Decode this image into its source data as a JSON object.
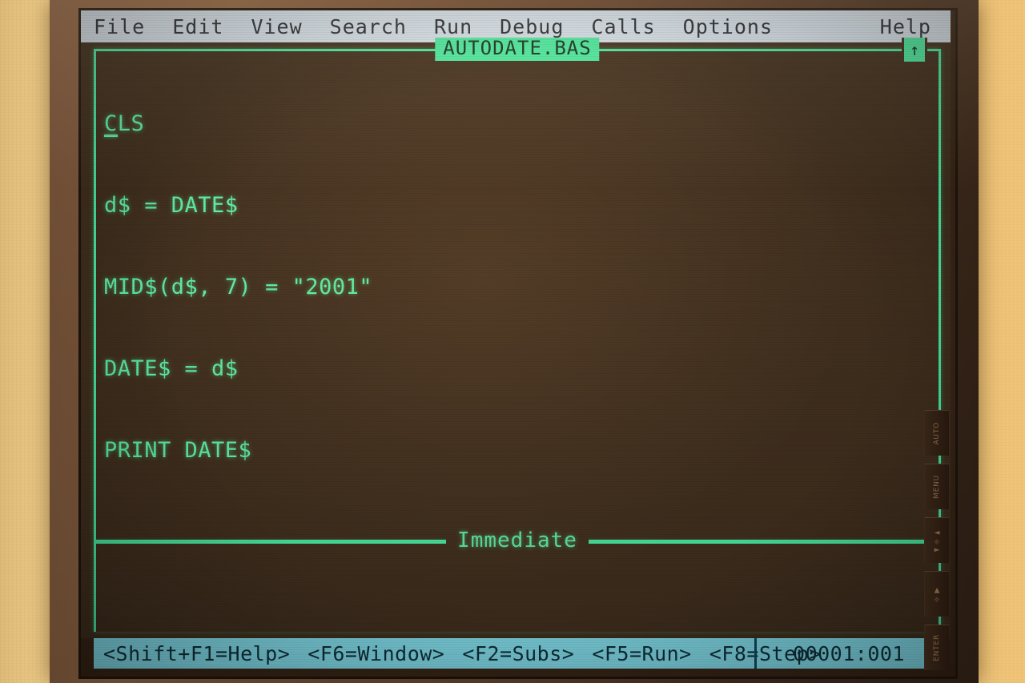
{
  "menu": {
    "items": [
      {
        "label": "File"
      },
      {
        "label": "Edit"
      },
      {
        "label": "View"
      },
      {
        "label": "Search"
      },
      {
        "label": "Run"
      },
      {
        "label": "Debug"
      },
      {
        "label": "Calls"
      },
      {
        "label": "Options"
      }
    ],
    "help_label": "Help"
  },
  "edit_window": {
    "title": "AUTODATE.BAS",
    "scroll_up_icon": "↑",
    "code_lines": [
      "CLS",
      "d$ = DATE$",
      "MID$(d$, 7) = \"2001\"",
      "DATE$ = d$",
      "PRINT DATE$"
    ]
  },
  "immediate_window": {
    "title": "Immediate",
    "content": ""
  },
  "statusbar": {
    "keys": [
      "<Shift+F1=Help>",
      "<F6=Window>",
      "<F2=Subs>",
      "<F5=Run>",
      "<F8=Step>"
    ],
    "position": "00001:001"
  },
  "monitor": {
    "buttons": [
      {
        "label": "AUTO"
      },
      {
        "label": "MENU"
      },
      {
        "label": "◄☼►"
      },
      {
        "label": "☼▼"
      },
      {
        "label": "ENTER"
      }
    ]
  },
  "colors": {
    "screen_bg": "#42301f",
    "qb_green": "#5ff5a8",
    "title_bg": "#4bf0a5",
    "menubar_bg": "#dbe8f4",
    "menubar_fg": "#2b3038",
    "status_bg": "#86e4f2",
    "status_fg": "#11323d",
    "wall": "#f3d18c",
    "bezel": "#6d4c35"
  }
}
